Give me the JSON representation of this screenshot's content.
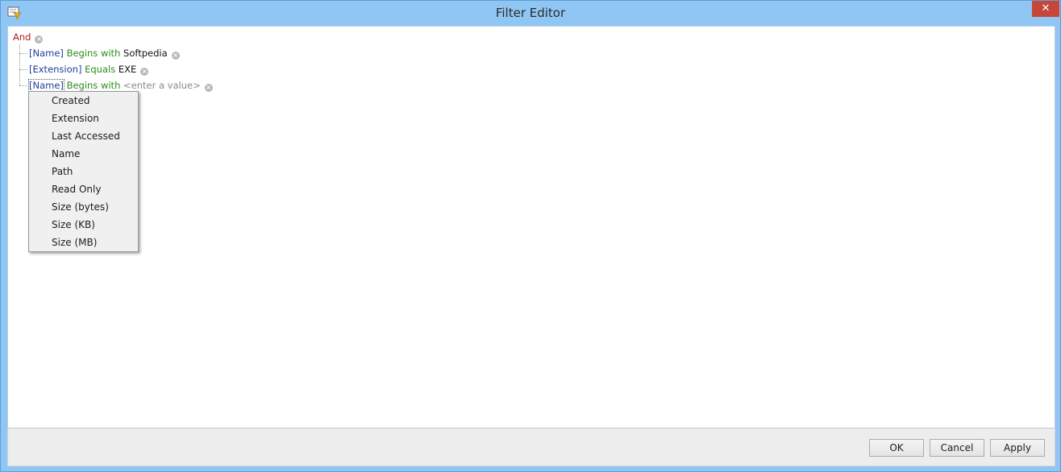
{
  "window": {
    "title": "Filter Editor",
    "close_label": "✕",
    "app_icon": "filter-editor-icon"
  },
  "filter": {
    "root_operator": "And",
    "conditions": [
      {
        "field": "[Name]",
        "operator": "Begins with",
        "value": "Softpedia"
      },
      {
        "field": "[Extension]",
        "operator": "Equals",
        "value": "EXE"
      },
      {
        "field": "[Name]",
        "operator": "Begins with",
        "value": "<enter a value>"
      }
    ],
    "remove_glyph": "×"
  },
  "field_menu": {
    "items": [
      "Created",
      "Extension",
      "Last Accessed",
      "Name",
      "Path",
      "Read Only",
      "Size (bytes)",
      "Size (KB)",
      "Size (MB)"
    ]
  },
  "footer": {
    "ok_label": "OK",
    "cancel_label": "Cancel",
    "apply_label": "Apply"
  },
  "colors": {
    "and_operator": "#b31b1b",
    "field": "#1f3f9c",
    "operator": "#2e8b1e",
    "close_button": "#c7463a"
  }
}
